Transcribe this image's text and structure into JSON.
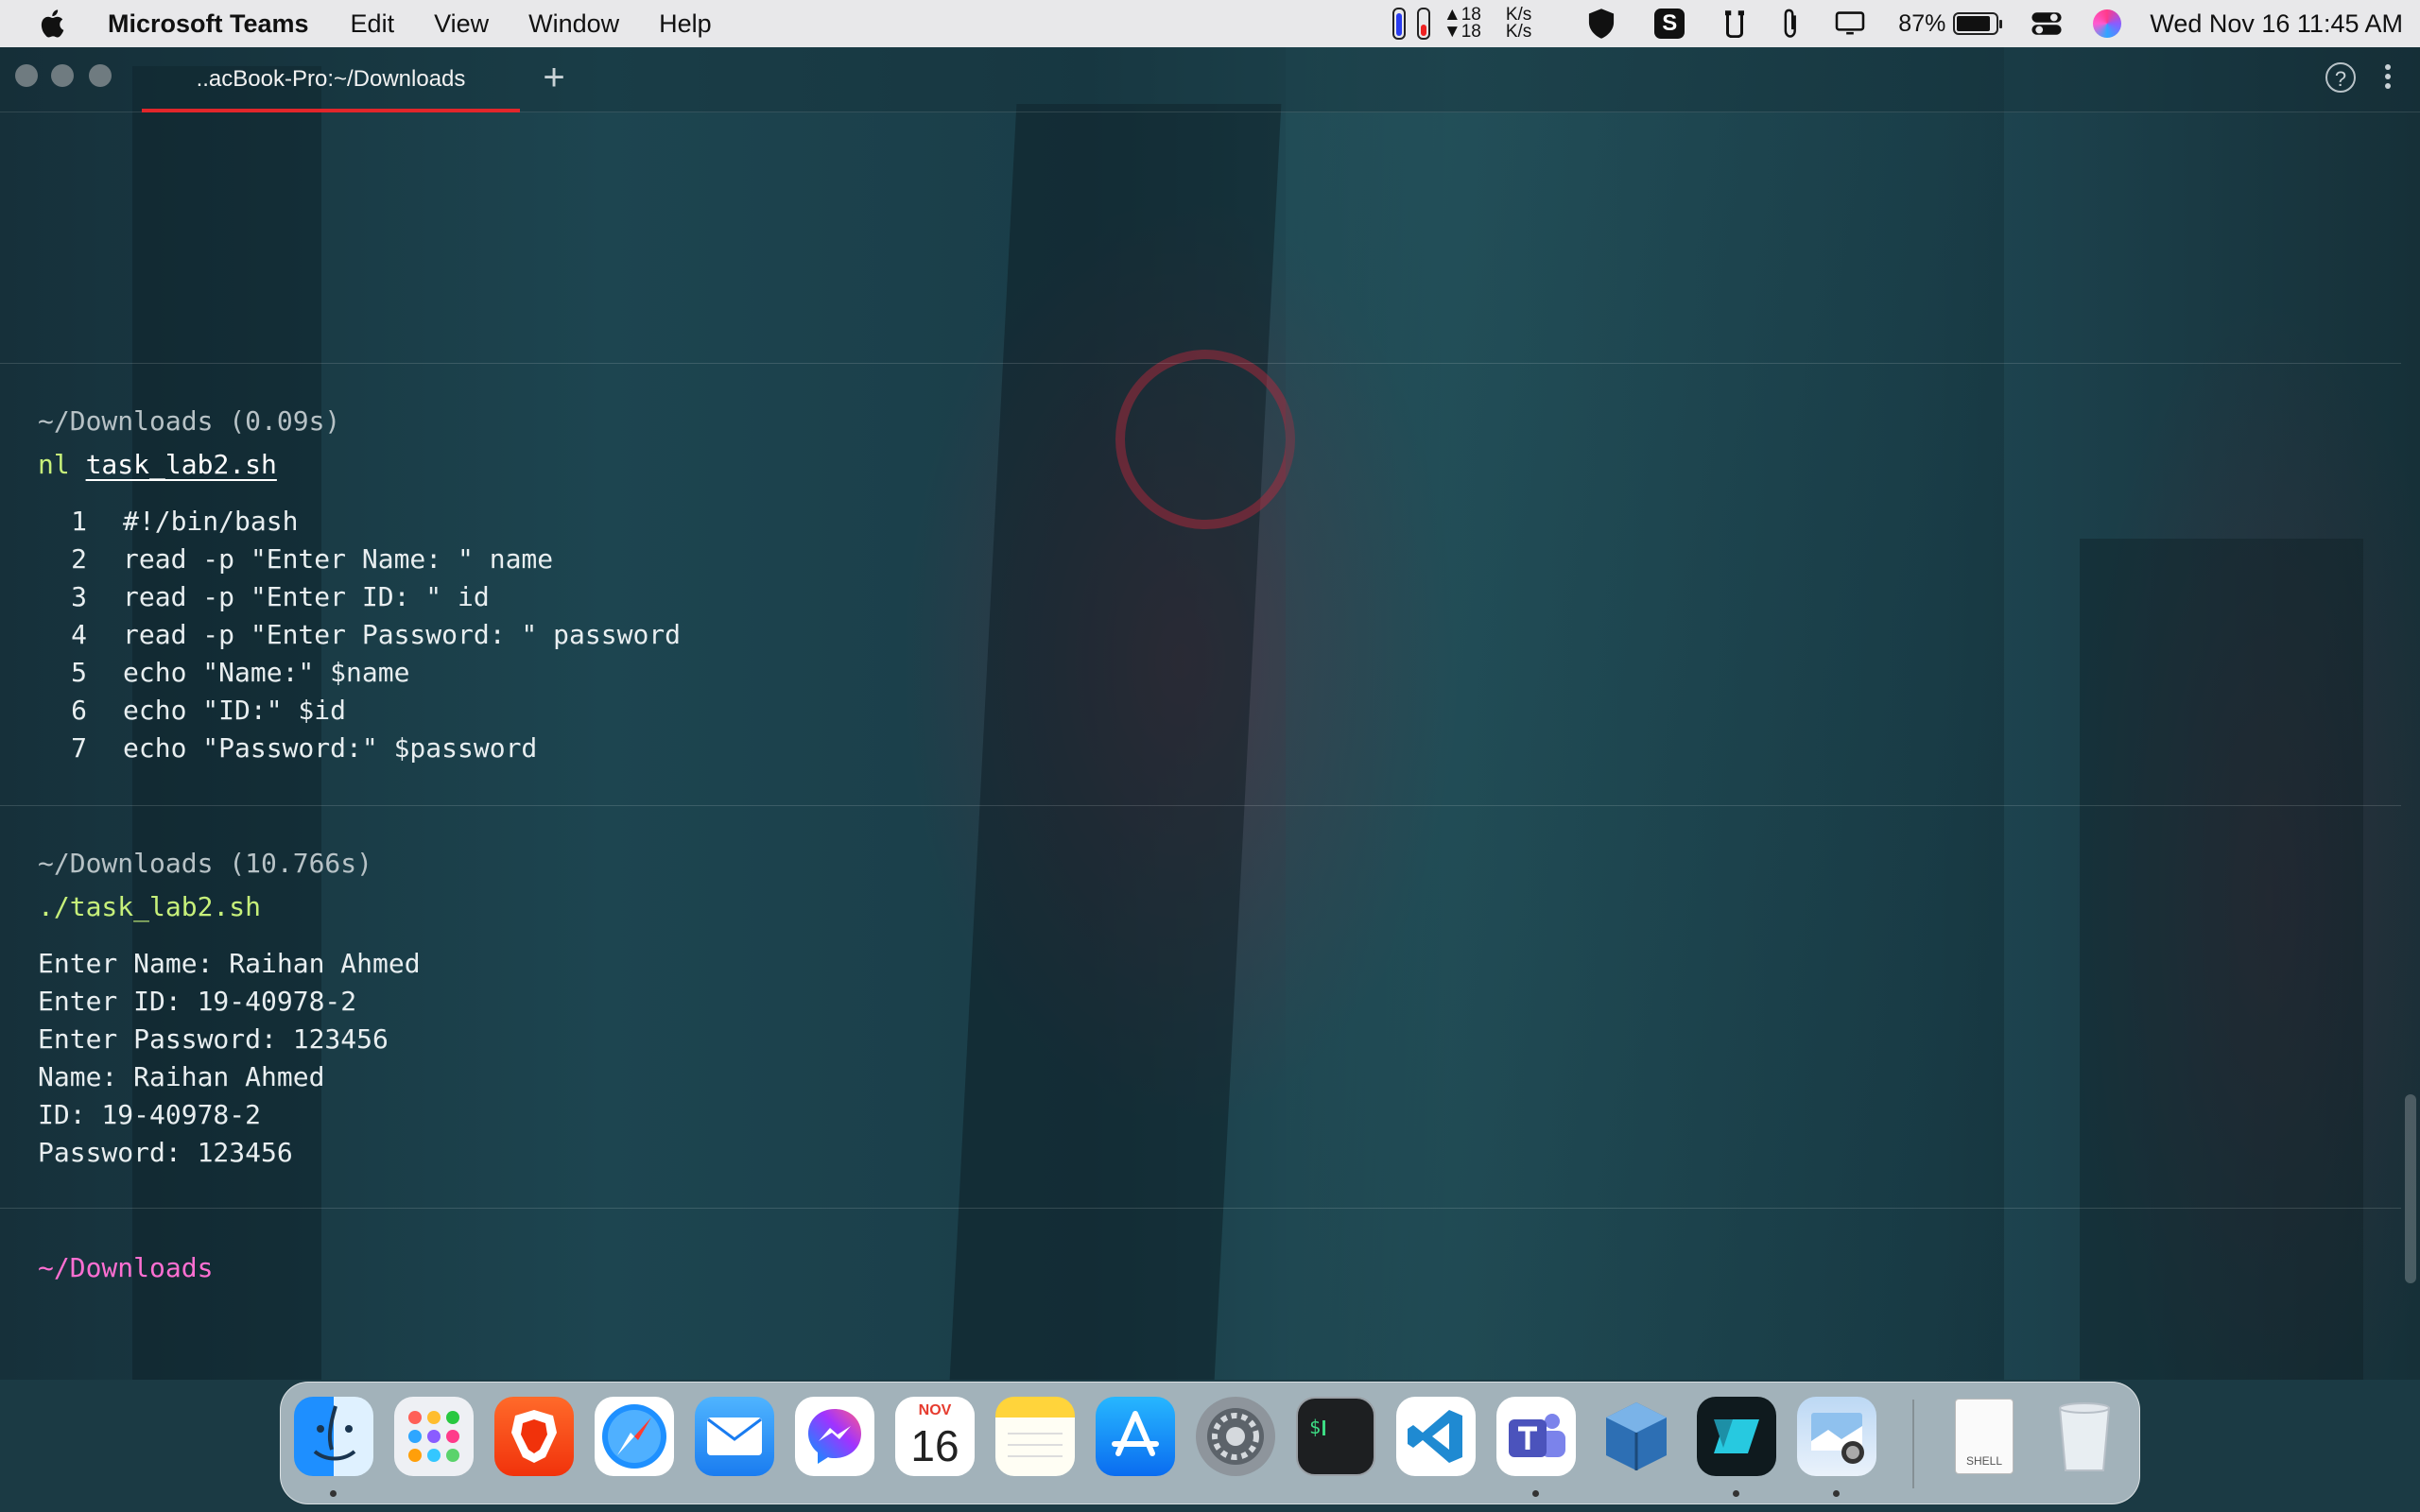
{
  "menubar": {
    "app_name": "Microsoft Teams",
    "menus": [
      "Edit",
      "View",
      "Window",
      "Help"
    ],
    "net_up": "▲18",
    "net_down": "▼18",
    "net_unit_up": "K/s",
    "net_unit_down": "K/s",
    "s_icon_text": "S",
    "battery_percent": "87%",
    "battery_level": 0.87,
    "datetime": "Wed Nov 16  11:45 AM"
  },
  "window": {
    "tab_title": "..acBook-Pro:~/Downloads",
    "new_tab_label": "+",
    "help_label": "?"
  },
  "terminal": {
    "block1": {
      "header": "~/Downloads (0.09s)",
      "cmd": "nl",
      "arg": "task_lab2.sh",
      "lines": [
        {
          "n": "1",
          "text": "#!/bin/bash"
        },
        {
          "n": "2",
          "text": "read -p \"Enter Name: \" name"
        },
        {
          "n": "3",
          "text": "read -p \"Enter ID: \" id"
        },
        {
          "n": "4",
          "text": "read -p \"Enter Password: \" password"
        },
        {
          "n": "5",
          "text": "echo \"Name:\" $name"
        },
        {
          "n": "6",
          "text": "echo \"ID:\" $id"
        },
        {
          "n": "7",
          "text": "echo \"Password:\" $password"
        }
      ]
    },
    "block2": {
      "header": "~/Downloads (10.766s)",
      "cmd": "./task_lab2.sh",
      "output": [
        "Enter Name: Raihan Ahmed",
        "Enter ID: 19-40978-2",
        "Enter Password: 123456",
        "Name: Raihan Ahmed",
        "ID: 19-40978-2",
        "Password: 123456"
      ]
    },
    "prompt": "~/Downloads"
  },
  "dock": {
    "calendar_month": "NOV",
    "calendar_day": "16",
    "shell_file_label": "SHELL",
    "apps": [
      "finder-icon",
      "launchpad-icon",
      "brave-icon",
      "safari-icon",
      "mail-icon",
      "messenger-icon",
      "calendar-icon",
      "notes-icon",
      "app-store-icon",
      "system-preferences-icon",
      "terminal-icon",
      "vscode-icon",
      "teams-icon",
      "virtualbox-icon",
      "warp-icon",
      "preview-icon"
    ]
  },
  "colors": {
    "tab_underline": "#e1262b",
    "cmd_green": "#c7f07a",
    "prompt_pink": "#ff6fd2"
  }
}
